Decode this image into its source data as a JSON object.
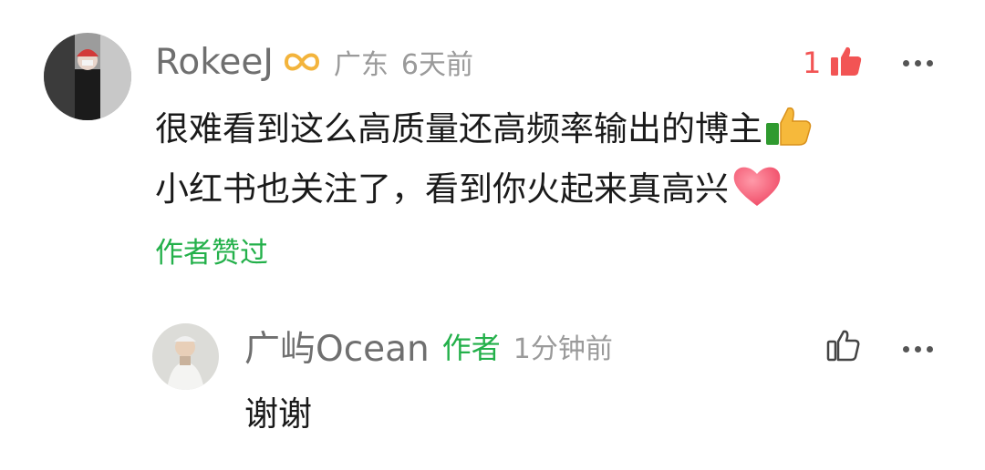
{
  "comment": {
    "username": "RokeeJ",
    "badge_icon": "infinity-badge-icon",
    "location": "广东",
    "time": "6天前",
    "like_count": "1",
    "line1": "很难看到这么高质量还高频率输出的博主",
    "line2": "小红书也关注了，看到你火起来真高兴",
    "author_liked": "作者赞过"
  },
  "reply": {
    "username": "广屿Ocean",
    "author_tag": "作者",
    "time": "1分钟前",
    "text": "谢谢"
  },
  "colors": {
    "green": "#23b04a",
    "like_red": "#f25454",
    "meta_gray": "#9a9a9a"
  }
}
